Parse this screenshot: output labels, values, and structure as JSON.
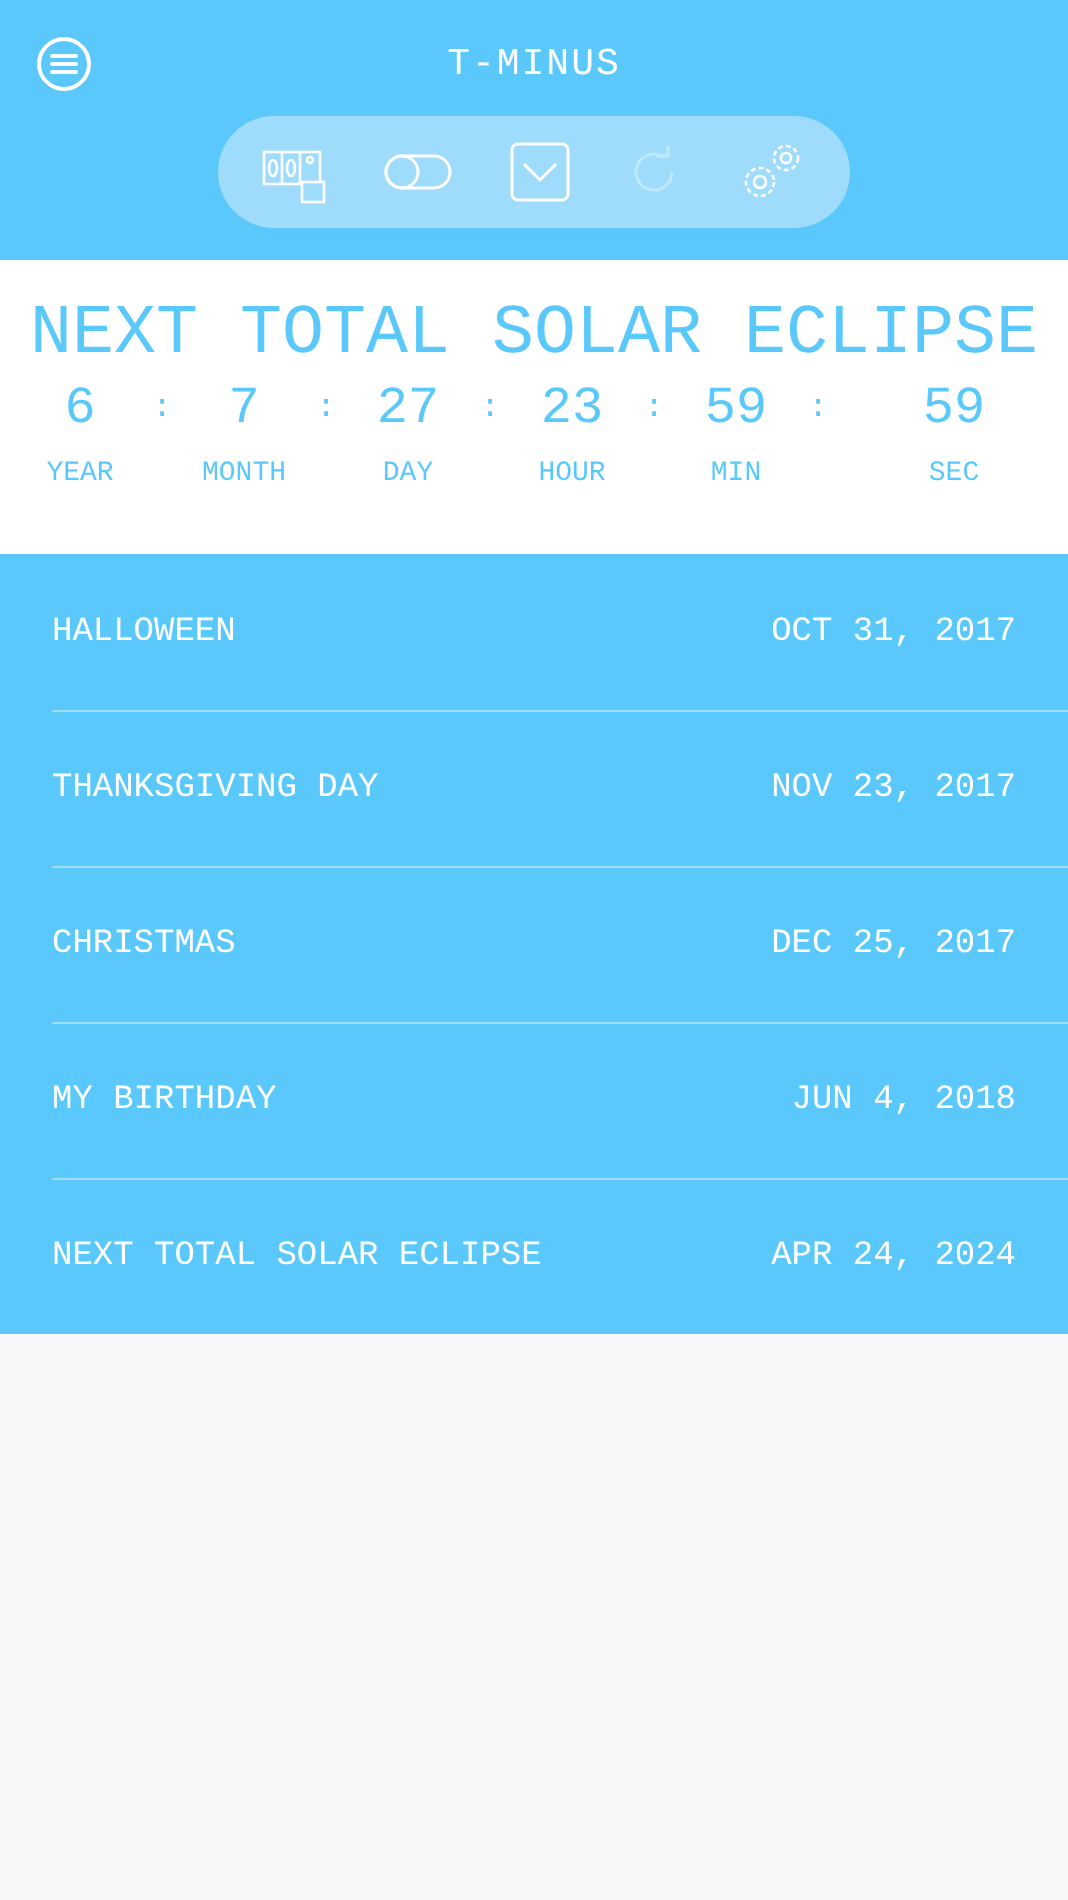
{
  "header": {
    "title": "T-MINUS"
  },
  "toolbar": [
    {
      "disabled": false
    },
    {
      "disabled": false
    },
    {
      "disabled": false
    },
    {
      "disabled": true
    },
    {
      "disabled": false
    }
  ],
  "countdown": {
    "title": "NEXT TOTAL SOLAR ECLIPSE",
    "separator": ":",
    "units": [
      {
        "value": "6",
        "label": "YEAR"
      },
      {
        "value": "7",
        "label": "MONTH"
      },
      {
        "value": "27",
        "label": "DAY"
      },
      {
        "value": "23",
        "label": "HOUR"
      },
      {
        "value": "59",
        "label": "MIN"
      },
      {
        "value": "59",
        "label": "SEC"
      }
    ]
  },
  "events": [
    {
      "name": "HALLOWEEN",
      "date": "OCT 31, 2017"
    },
    {
      "name": "THANKSGIVING DAY",
      "date": "NOV 23, 2017"
    },
    {
      "name": "CHRISTMAS",
      "date": "DEC 25, 2017"
    },
    {
      "name": "MY BIRTHDAY",
      "date": "JUN 4, 2018"
    },
    {
      "name": "NEXT TOTAL SOLAR ECLIPSE",
      "date": "APR 24, 2024"
    }
  ]
}
